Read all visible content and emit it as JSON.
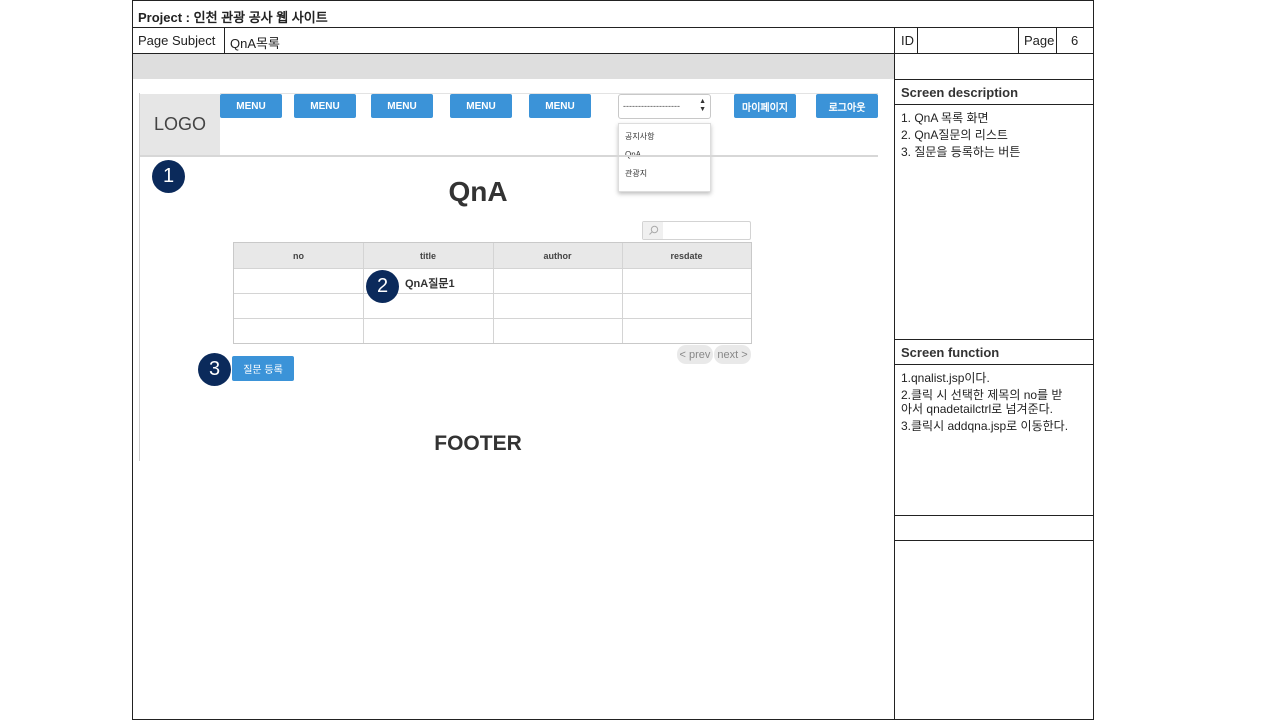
{
  "header": {
    "project_title": "Project : 인천 관광 공사 웹 사이트",
    "subject_label": "Page Subject",
    "subject_value": "QnA목록",
    "id_label": "ID",
    "id_value": "",
    "page_label": "Page",
    "page_value": "6"
  },
  "mockup": {
    "logo": "LOGO",
    "menu_items": [
      "MENU",
      "MENU",
      "MENU",
      "MENU",
      "MENU"
    ],
    "select": {
      "value": "-------------------",
      "options": [
        "공지사항",
        "QnA",
        "관광지"
      ]
    },
    "mypage_label": "마이페이지",
    "logout_label": "로그아웃",
    "page_title": "QnA",
    "search": {
      "value": ""
    },
    "table": {
      "columns": [
        "no",
        "title",
        "author",
        "resdate"
      ],
      "rows": [
        [
          "",
          "QnA질문1",
          "",
          ""
        ],
        [
          "",
          "",
          "",
          ""
        ],
        [
          "",
          "",
          "",
          ""
        ]
      ]
    },
    "pager": {
      "prev": "< prev",
      "next": "next >"
    },
    "register_label": "질문 등록",
    "footer": "FOOTER",
    "badges": [
      "1",
      "2",
      "3"
    ]
  },
  "sidebar": {
    "description_title": "Screen description",
    "description_lines": [
      "1.  QnA 목록 화면",
      "2.  QnA질문의 리스트",
      "3.  질문을 등록하는 버튼"
    ],
    "function_title": "Screen function",
    "function_lines": [
      "1.qnalist.jsp이다.",
      "2.클릭 시 선택한 제목의 no를 받",
      "아서 qnadetailctrl로 넘겨준다.",
      "3.클릭시 addqna.jsp로 이동한다."
    ]
  }
}
